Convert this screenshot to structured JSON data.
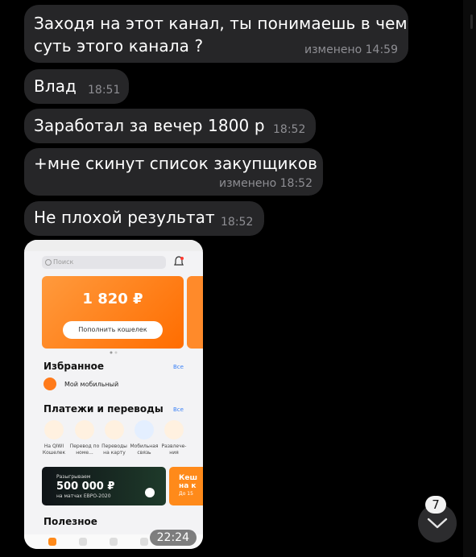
{
  "messages": [
    {
      "text_lines": [
        "Заходя на этот канал, ты понимаешь в чем",
        "суть этого канала ?"
      ],
      "time": "изменено 14:59"
    },
    {
      "text": "Влад",
      "time": "18:51"
    },
    {
      "text": "Заработал за вечер 1800 р",
      "time": "18:52"
    },
    {
      "text": "+мне скинут список закупщиков",
      "time": "изменено 18:52"
    },
    {
      "text": "Не плохой результат",
      "time": "18:52"
    }
  ],
  "media": {
    "duration": "22:24",
    "screen": {
      "search_placeholder": "Поиск",
      "balance": "1 820 ₽",
      "topup_button": "Пополнить кошелек",
      "favorites_title": "Избранное",
      "favorites_all": "Все",
      "favorite_item": "Мой мобильный",
      "payments_title": "Платежи и переводы",
      "payments_all": "Все",
      "payment_tiles": [
        {
          "label": "На QIWI Кошелек",
          "color": "#fff1e0"
        },
        {
          "label": "Перевод по номе...",
          "color": "#fff1e0"
        },
        {
          "label": "Переводы на карту",
          "color": "#fff1e0"
        },
        {
          "label": "Мобильная связь",
          "color": "#e4efff"
        },
        {
          "label": "Развлече-ния",
          "color": "#fff1e0"
        }
      ],
      "banner_small": "Разыгрываем",
      "banner_amount": "500 000 ₽",
      "banner_sub": "на матчах ЕВРО-2020",
      "banner2_title": "Кеш на к",
      "banner2_sub": "До 15",
      "useful_title": "Полезное"
    }
  },
  "unread_count": "7",
  "colors": {
    "bubble": "#262628",
    "accent": "#ff7a1a"
  }
}
